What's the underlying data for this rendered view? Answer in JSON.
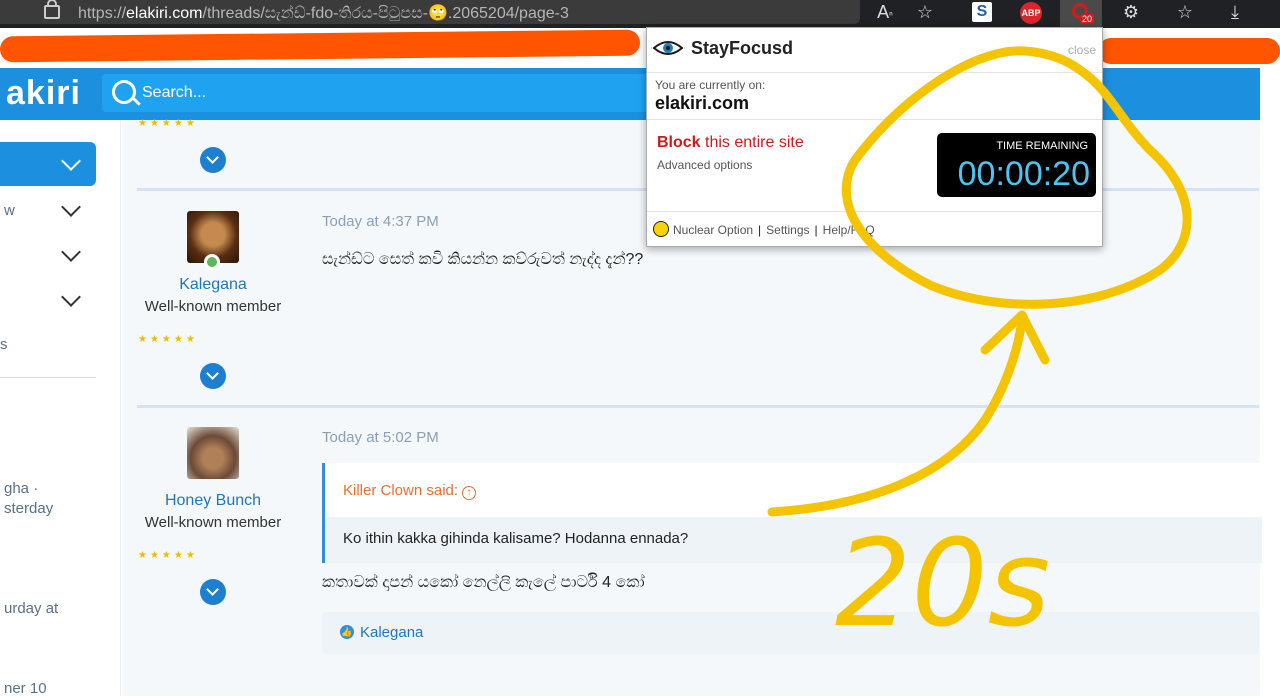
{
  "browser": {
    "url_prefix": "https://",
    "url_domain": "elakiri.com",
    "url_path": "/threads/සැන්ඩ්-fdo-තිරය-පිටුපස-🙄.2065204/page-3",
    "toolbar_icons": [
      "read-aloud-icon",
      "favorites-add-icon",
      "s-extension-icon",
      "adblock-plus-icon",
      "stayfocusd-icon",
      "extensions-icon",
      "favorites-icon",
      "downloads-icon"
    ],
    "abp_label": "ABP",
    "s_label": "S",
    "stayfocusd_badge": "20"
  },
  "site": {
    "logo_text": "akiri",
    "search_placeholder": "Search..."
  },
  "sidebar": {
    "items": [
      "w",
      "s",
      "gha ·",
      "sterday",
      "urday at",
      "ner 10"
    ]
  },
  "posts": [
    {
      "author": "Kalegana",
      "title": "Well-known member",
      "time": "Today at 4:37 PM",
      "text": "සැන්ඩ්ට සෙත් කවි කියන්න කව්රුවත් නැද්ද දැන්??"
    },
    {
      "author": "Honey Bunch",
      "title": "Well-known member",
      "time": "Today at 5:02 PM",
      "quote_author": "Killer Clown said:",
      "quote_text": "Ko ithin kakka gihinda kalisame? Hodanna ennada?",
      "text": "කතාවක් දාපන් යකෝ නෙල්ලි කැලේ පාර්ටි 4 කෝ",
      "likes": "Kalegana"
    }
  ],
  "stars": "★★★★★",
  "popup": {
    "brand": "StayFocusd",
    "close": "close",
    "current_label": "You are currently on:",
    "current_site": "elakiri.com",
    "block_bold": "Block",
    "block_rest": " this entire site",
    "advanced": "Advanced options",
    "timer_label": "TIME REMAINING",
    "timer_value": "00:00:20",
    "nuclear": "Nuclear Option",
    "settings": "Settings",
    "help": "Help/FAQ"
  },
  "annotation": {
    "handwritten_text": "20s",
    "color": "#f5c400"
  }
}
